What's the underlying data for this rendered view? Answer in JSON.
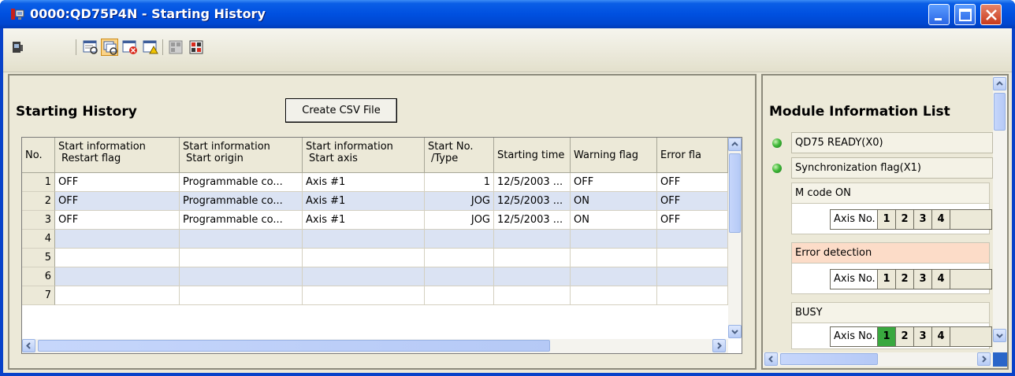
{
  "window": {
    "title": "0000:QD75P4N - Starting History"
  },
  "toolbar": {
    "buttons": [
      "monitor-icon",
      "history-icon",
      "start-history-icon",
      "error-history-icon",
      "warning-history-icon",
      "module-info-icon",
      "module-error-icon"
    ]
  },
  "main": {
    "section_title": "Starting History",
    "csv_button": "Create CSV File",
    "table": {
      "headers": [
        {
          "line1": "No.",
          "line2": ""
        },
        {
          "line1": "Start information",
          "line2": "Restart flag"
        },
        {
          "line1": "Start information",
          "line2": "Start origin"
        },
        {
          "line1": "Start information",
          "line2": "Start axis"
        },
        {
          "line1": "Start No.",
          "line2": "/Type"
        },
        {
          "line1": "Starting time",
          "line2": ""
        },
        {
          "line1": "Warning flag",
          "line2": ""
        },
        {
          "line1": "Error fla",
          "line2": ""
        }
      ],
      "rows": [
        {
          "no": "1",
          "restart": "OFF",
          "origin": "Programmable co...",
          "axis": "Axis #1",
          "startno": "1",
          "time": "12/5/2003 ...",
          "warning": "OFF",
          "error": "OFF"
        },
        {
          "no": "2",
          "restart": "OFF",
          "origin": "Programmable co...",
          "axis": "Axis #1",
          "startno": "JOG",
          "time": "12/5/2003 ...",
          "warning": "ON",
          "error": "OFF"
        },
        {
          "no": "3",
          "restart": "OFF",
          "origin": "Programmable co...",
          "axis": "Axis #1",
          "startno": "JOG",
          "time": "12/5/2003 ...",
          "warning": "ON",
          "error": "OFF"
        },
        {
          "no": "4",
          "restart": "",
          "origin": "",
          "axis": "",
          "startno": "",
          "time": "",
          "warning": "",
          "error": ""
        },
        {
          "no": "5",
          "restart": "",
          "origin": "",
          "axis": "",
          "startno": "",
          "time": "",
          "warning": "",
          "error": ""
        },
        {
          "no": "6",
          "restart": "",
          "origin": "",
          "axis": "",
          "startno": "",
          "time": "",
          "warning": "",
          "error": ""
        },
        {
          "no": "7",
          "restart": "",
          "origin": "",
          "axis": "",
          "startno": "",
          "time": "",
          "warning": "",
          "error": ""
        }
      ]
    }
  },
  "side": {
    "title": "Module Information List",
    "ready": "QD75 READY(X0)",
    "sync": "Synchronization flag(X1)",
    "groups": [
      {
        "label": "M code ON",
        "axis_label": "Axis No.",
        "axes": [
          "1",
          "2",
          "3",
          "4"
        ],
        "active": []
      },
      {
        "label": "Error detection",
        "axis_label": "Axis No.",
        "axes": [
          "1",
          "2",
          "3",
          "4"
        ],
        "active": []
      },
      {
        "label": "BUSY",
        "axis_label": "Axis No.",
        "axes": [
          "1",
          "2",
          "3",
          "4"
        ],
        "active": [
          "1"
        ]
      }
    ]
  },
  "colors": {
    "title_bar": "#0050e0",
    "row_alt": "#dbe3f3",
    "led_green": "#41b93a",
    "error_head": "#fcdcc8",
    "axis_active": "#39a83f"
  }
}
